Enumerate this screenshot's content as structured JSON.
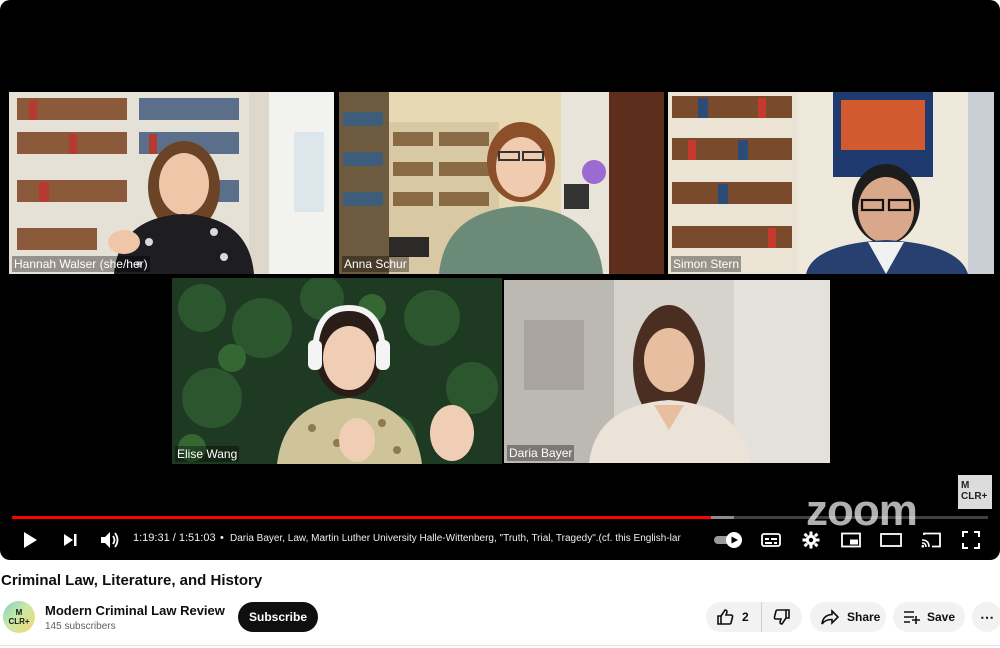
{
  "video": {
    "title": "Criminal Law, Literature, and History",
    "current_time": "1:19:31",
    "duration": "1:51:03",
    "time_display": "1:19:31 / 1:51:03",
    "separator": "•",
    "chapter_text": "Daria Bayer, Law, Martin Luther University Halle-Wittenberg, \"Truth, Trial, Tragedy\".(cf. this English-lar",
    "progress_played": 0.716,
    "progress_buffered": 0.74
  },
  "participants": [
    {
      "name": "Hannah Walser (she/her)",
      "active": false
    },
    {
      "name": "Anna Schur",
      "active": false
    },
    {
      "name": "Simon Stern",
      "active": false
    },
    {
      "name": "Elise Wang",
      "active": true
    },
    {
      "name": "Daria Bayer",
      "active": false
    }
  ],
  "overlay": {
    "watermark": "zoom",
    "channel_mark": "M\nCLR+"
  },
  "controls": {
    "icons": [
      "play-icon",
      "next-icon",
      "volume-icon",
      "autoplay-toggle-icon",
      "subtitles-icon",
      "settings-icon",
      "miniplayer-icon",
      "theater-icon",
      "cast-icon",
      "fullscreen-icon"
    ]
  },
  "channel": {
    "name": "Modern Criminal Law Review",
    "avatar_text": "M\nCLR+",
    "subscribers": "145 subscribers",
    "subscribe_label": "Subscribe"
  },
  "actions": {
    "like_count": "2",
    "share_label": "Share",
    "save_label": "Save",
    "more_label": "⋯"
  },
  "colors": {
    "progress": "#ff0000",
    "active_speaker_border": "#7ec24f",
    "subscribe_bg": "#0f0f0f"
  }
}
